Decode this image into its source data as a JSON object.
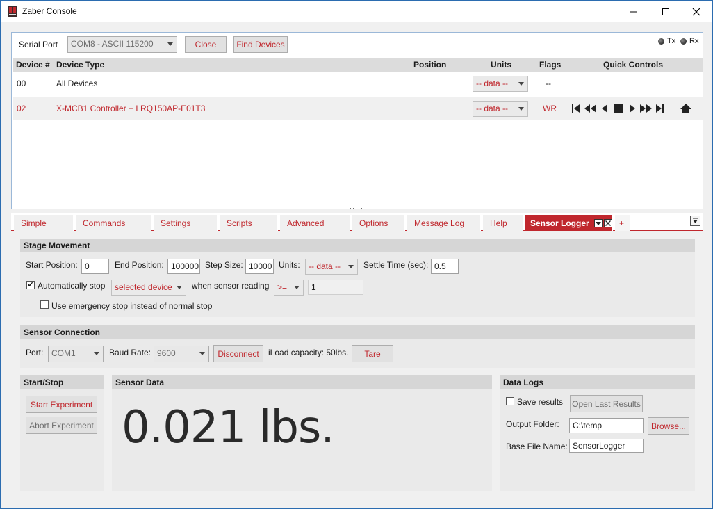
{
  "window": {
    "title": "Zaber Console"
  },
  "toolbar": {
    "serial_port_label": "Serial Port",
    "serial_port_value": "COM8 - ASCII 115200",
    "close_label": "Close",
    "find_devices_label": "Find Devices",
    "tx_label": "Tx",
    "rx_label": "Rx"
  },
  "grid": {
    "headers": {
      "device_num": "Device #",
      "device_type": "Device Type",
      "position": "Position",
      "units": "Units",
      "flags": "Flags",
      "quick_controls": "Quick Controls"
    },
    "rows": [
      {
        "device_num": "00",
        "device_type": "All Devices",
        "units": "-- data --",
        "flags": "--"
      },
      {
        "device_num": "02",
        "device_type": "X-MCB1 Controller + LRQ150AP-E01T3",
        "units": "-- data --",
        "flags": "WR"
      }
    ]
  },
  "tabs": [
    {
      "label": "Simple"
    },
    {
      "label": "Commands"
    },
    {
      "label": "Settings"
    },
    {
      "label": "Scripts"
    },
    {
      "label": "Advanced"
    },
    {
      "label": "Options"
    },
    {
      "label": "Message Log"
    },
    {
      "label": "Help"
    },
    {
      "label": "Sensor Logger",
      "active": true
    },
    {
      "label": "+"
    }
  ],
  "stage_movement": {
    "heading": "Stage Movement",
    "start_position_label": "Start Position:",
    "start_position_value": "0",
    "end_position_label": "End Position:",
    "end_position_value": "100000",
    "step_size_label": "Step Size:",
    "step_size_value": "10000",
    "units_label": "Units:",
    "units_value": "-- data --",
    "settle_time_label": "Settle Time (sec):",
    "settle_time_value": "0.5",
    "auto_stop_label": "Automatically stop",
    "auto_stop_checked": true,
    "auto_stop_target": "selected device",
    "when_sensor_label": "when sensor reading",
    "comparator": ">=",
    "threshold": "1",
    "emergency_label": "Use emergency stop instead of normal stop",
    "emergency_checked": false
  },
  "sensor_connection": {
    "heading": "Sensor Connection",
    "port_label": "Port:",
    "port_value": "COM1",
    "baud_label": "Baud Rate:",
    "baud_value": "9600",
    "disconnect_label": "Disconnect",
    "capacity_text": "iLoad capacity: 50lbs.",
    "tare_label": "Tare"
  },
  "start_stop": {
    "heading": "Start/Stop",
    "start_label": "Start Experiment",
    "abort_label": "Abort Experiment"
  },
  "sensor_data": {
    "heading": "Sensor Data",
    "reading": "0.021 lbs."
  },
  "data_logs": {
    "heading": "Data Logs",
    "save_results_label": "Save results",
    "save_results_checked": false,
    "open_last_label": "Open Last Results",
    "output_folder_label": "Output Folder:",
    "output_folder_value": "C:\\temp",
    "browse_label": "Browse...",
    "base_file_label": "Base File Name:",
    "base_file_value": "SensorLogger"
  },
  "colors": {
    "accent": "#c0272d",
    "frame": "#2b6cb0"
  }
}
